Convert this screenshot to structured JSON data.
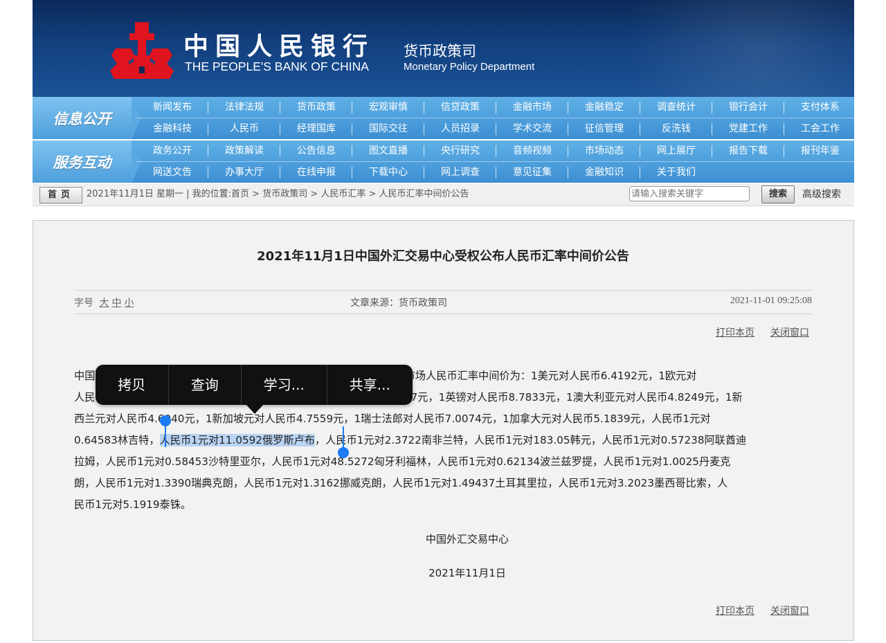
{
  "header": {
    "bank_name_cn": "中国人民银行",
    "bank_name_en": "THE PEOPLE'S BANK OF CHINA",
    "dept_cn": "货币政策司",
    "dept_en": "Monetary Policy Department",
    "logo_color": "#e0141e"
  },
  "nav": {
    "section1_title": "信息公开",
    "section1_row1": [
      "新闻发布",
      "法律法规",
      "货币政策",
      "宏观审慎",
      "信贷政策",
      "金融市场",
      "金融稳定",
      "调查统计",
      "银行会计",
      "支付体系"
    ],
    "section1_row2": [
      "金融科技",
      "人民币",
      "经理国库",
      "国际交往",
      "人员招录",
      "学术交流",
      "征信管理",
      "反洗钱",
      "党建工作",
      "工会工作"
    ],
    "section2_title": "服务互动",
    "section2_row1": [
      "政务公开",
      "政策解读",
      "公告信息",
      "图文直播",
      "央行研究",
      "音频视频",
      "市场动态",
      "网上展厅",
      "报告下载",
      "报刊年鉴"
    ],
    "section2_row2": [
      "网送文告",
      "办事大厅",
      "在线申报",
      "下载中心",
      "网上调查",
      "意见征集",
      "金融知识",
      "关于我们"
    ]
  },
  "breadcrumb": {
    "home_label": "首页",
    "text": "2021年11月1日 星期一 | 我的位置:首页 > 货币政策司 > 人民币汇率 > 人民币汇率中间价公告",
    "search_placeholder": "请输入搜索关键字",
    "search_button": "搜索",
    "advanced_search": "高级搜索"
  },
  "article": {
    "title": "2021年11月1日中国外汇交易中心受权公布人民币汇率中间价公告",
    "font_size_label": "字号",
    "font_sizes": [
      "大",
      "中",
      "小"
    ],
    "source": "文章来源：货币政策司",
    "date": "2021-11-01 09:25:08",
    "print_label": "打印本页",
    "close_label": "关闭窗口",
    "lines": [
      "中国人民银行授权中国外汇交易中心公布，2021年11月1日银行间外汇市场人民币汇率中间价为：1美元对人民币6.4192元，1欧元对",
      "人民币7.4229元，100日元对人民币5.6300元，1港元对人民币0.82517元，1英镑对人民币8.7833元，1澳大利亚元对人民币4.8249元，1新",
      "西兰元对人民币4.6040元，1新加坡元对人民币4.7559元，1瑞士法郎对人民币7.0074元，1加拿大元对人民币5.1839元，人民币1元对",
      "0.64583林吉特，",
      "人民币1元对11.0592俄罗斯卢布",
      "，人民币1元对2.3722南非兰特，人民币1元对183.05韩元，人民币1元对0.57238阿联酋迪",
      "拉姆，人民币1元对0.58453沙特里亚尔，人民币1元对48.5272匈牙利福林，人民币1元对0.62134波兰兹罗提，人民币1元对1.0025丹麦克",
      "朗，人民币1元对1.3390瑞典克朗，人民币1元对1.3162挪威克朗，人民币1元对1.49437土耳其里拉，人民币1元对3.2023墨西哥比索，人",
      "民币1元对5.1919泰铢。"
    ],
    "signature_org": "中国外汇交易中心",
    "signature_date": "2021年11月1日"
  },
  "context_menu": {
    "items": [
      "拷贝",
      "查询",
      "学习...",
      "共享..."
    ]
  },
  "colors": {
    "banner": "#12407f",
    "nav": "#4a9bd9",
    "selection": "#b9d4f3",
    "handle": "#1a7bf2"
  }
}
